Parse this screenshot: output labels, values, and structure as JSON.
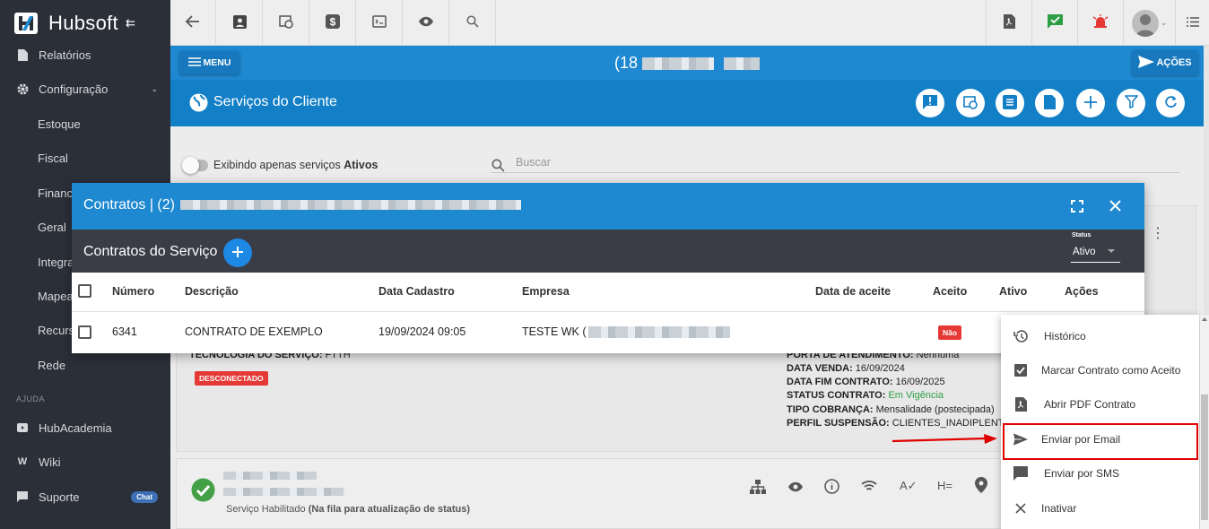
{
  "app": {
    "name_part1": "Hub",
    "name_part2": "soft"
  },
  "sidebar": {
    "items": [
      {
        "label": "Relatórios",
        "icon": "file-icon"
      },
      {
        "label": "Configuração",
        "icon": "gear-icon"
      },
      {
        "label": "Estoque"
      },
      {
        "label": "Fiscal"
      },
      {
        "label": "Financ"
      },
      {
        "label": "Geral"
      },
      {
        "label": "Integra"
      },
      {
        "label": "Mapea"
      },
      {
        "label": "Recurs"
      },
      {
        "label": "Rede"
      }
    ],
    "section_help": "AJUDA",
    "help_items": [
      {
        "label": "HubAcademia",
        "icon": "play-icon"
      },
      {
        "label": "Wiki",
        "icon": "wiki-icon"
      },
      {
        "label": "Suporte",
        "icon": "chat-icon",
        "badge": "Chat"
      }
    ]
  },
  "bluebar": {
    "menu_label": "MENU",
    "client_prefix": "(18",
    "acoes_label": "AÇÕES"
  },
  "subheader": {
    "title": "Serviços do Cliente"
  },
  "filters": {
    "toggle_text": "Exibindo apenas serviços ",
    "toggle_bold": "Ativos",
    "search_placeholder": "Buscar"
  },
  "service": {
    "tech_label": "TECNOLOGIA DO SERVIÇO:",
    "tech_value": "FTTH",
    "status_badge": "DESCONECTADO",
    "details": [
      {
        "label": "PORTA DE ATENDIMENTO:",
        "value": "Nenhuma"
      },
      {
        "label": "DATA VENDA:",
        "value": "16/09/2024"
      },
      {
        "label": "DATA FIM CONTRATO:",
        "value": "16/09/2025"
      },
      {
        "label": "STATUS CONTRATO:",
        "value": "Em Vigência"
      },
      {
        "label": "TIPO COBRANÇA:",
        "value": "Mensalidade (postecipada)"
      },
      {
        "label": "PERFIL SUSPENSÃO:",
        "value": "CLIENTES_INADIPLENTES"
      }
    ],
    "footer_status": "Serviço Habilitado",
    "footer_note": "(Na fila para atualização de status)"
  },
  "modal": {
    "title": "Contratos | (2)",
    "subtitle": "Contratos do Serviço",
    "status_label": "Status",
    "status_value": "Ativo",
    "columns": [
      "Número",
      "Descrição",
      "Data Cadastro",
      "Empresa",
      "Data de aceite",
      "Aceito",
      "Ativo",
      "Ações"
    ],
    "rows": [
      {
        "numero": "6341",
        "descricao": "CONTRATO DE EXEMPLO",
        "data_cadastro": "19/09/2024 09:05",
        "empresa": "TESTE WK (",
        "aceito": "Não"
      }
    ]
  },
  "dropdown": {
    "items": [
      {
        "label": "Histórico",
        "icon": "history-icon"
      },
      {
        "label": "Marcar Contrato como Aceito",
        "icon": "check-box-icon"
      },
      {
        "label": "Abrir PDF Contrato",
        "icon": "pdf-icon"
      },
      {
        "label": "Enviar por Email",
        "icon": "send-icon"
      },
      {
        "label": "Enviar por SMS",
        "icon": "sms-icon"
      },
      {
        "label": "Inativar",
        "icon": "close-icon"
      }
    ]
  },
  "colors": {
    "primary": "#1e88d0",
    "sidebar": "#2b2f38",
    "danger": "#e53935",
    "highlight": "#e00000"
  }
}
